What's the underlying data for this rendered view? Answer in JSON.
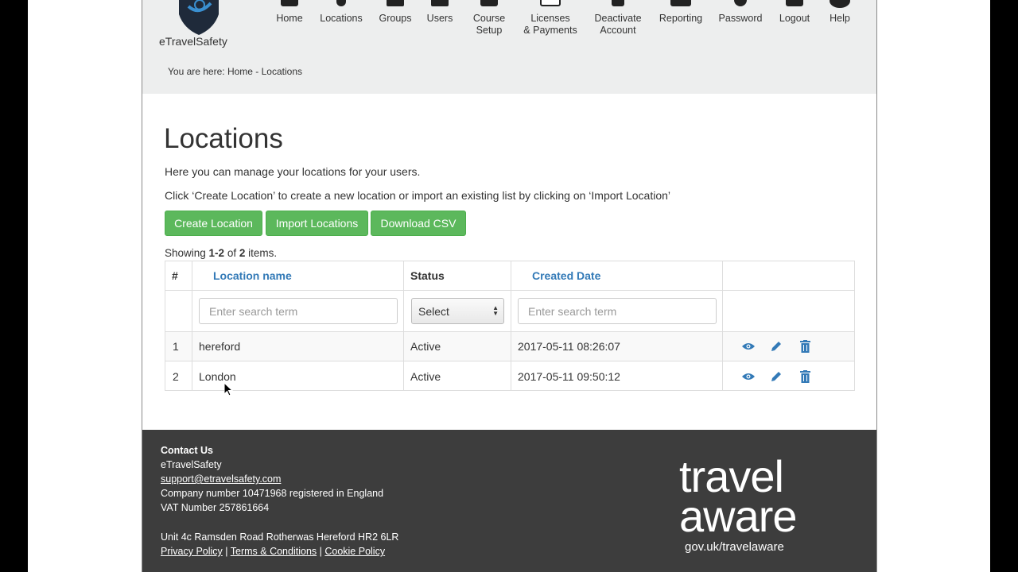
{
  "brand": {
    "name": "eTravelSafety"
  },
  "nav": [
    {
      "label": "Home",
      "icon": "home-icon"
    },
    {
      "label": "Locations",
      "icon": "map-pin-icon"
    },
    {
      "label": "Groups",
      "icon": "group-icon"
    },
    {
      "label": "Users",
      "icon": "user-icon"
    },
    {
      "label": "Course",
      "label2": "Setup",
      "icon": "course-icon"
    },
    {
      "label": "Licenses",
      "label2": "& Payments",
      "icon": "license-icon"
    },
    {
      "label": "Deactivate",
      "label2": "Account",
      "icon": "trash-icon"
    },
    {
      "label": "Reporting",
      "icon": "report-icon"
    },
    {
      "label": "Password",
      "icon": "gear-icon"
    },
    {
      "label": "Logout",
      "icon": "logout-icon"
    },
    {
      "label": "Help",
      "icon": "lifebuoy-icon"
    }
  ],
  "breadcrumb": "You are here: Home - Locations",
  "main": {
    "title": "Locations",
    "desc1": "Here you can manage your locations for your users.",
    "desc2": "Click ‘Create Location’ to create a new location or import an existing list by clicking on ‘Import Location’",
    "buttons": {
      "create": "Create Location",
      "import": "Import Locations",
      "download": "Download CSV"
    },
    "summary": {
      "prefix": "Showing ",
      "range": "1-2",
      "of": " of ",
      "total": "2",
      "suffix": " items."
    }
  },
  "table": {
    "headers": {
      "num": "#",
      "name": "Location name",
      "status": "Status",
      "created": "Created Date"
    },
    "filters": {
      "name_placeholder": "Enter search term",
      "status_selected": "Select",
      "created_placeholder": "Enter search term"
    },
    "rows": [
      {
        "num": "1",
        "name": "hereford",
        "status": "Active",
        "created": "2017-05-11 08:26:07"
      },
      {
        "num": "2",
        "name": "London",
        "status": "Active",
        "created": "2017-05-11 09:50:12"
      }
    ]
  },
  "footer": {
    "contact_title": "Contact Us",
    "company": "eTravelSafety",
    "email": "support@etravelsafety.com",
    "company_number": "Company number 10471968 registered in England",
    "vat": "VAT Number 257861664",
    "address": "Unit 4c Ramsden Road Rotherwas Hereford HR2 6LR",
    "links": {
      "privacy": "Privacy Policy",
      "sep": " | ",
      "terms": "Terms & Conditions",
      "cookie": "Cookie Policy"
    },
    "travelaware": {
      "line1": "travel",
      "line2": "aware",
      "url": "gov.uk/travelaware"
    }
  },
  "colors": {
    "accent_green": "#5cb85c",
    "link_blue": "#337ab7",
    "footer_bg": "#3d3d3d",
    "header_bg": "#edeeee"
  }
}
